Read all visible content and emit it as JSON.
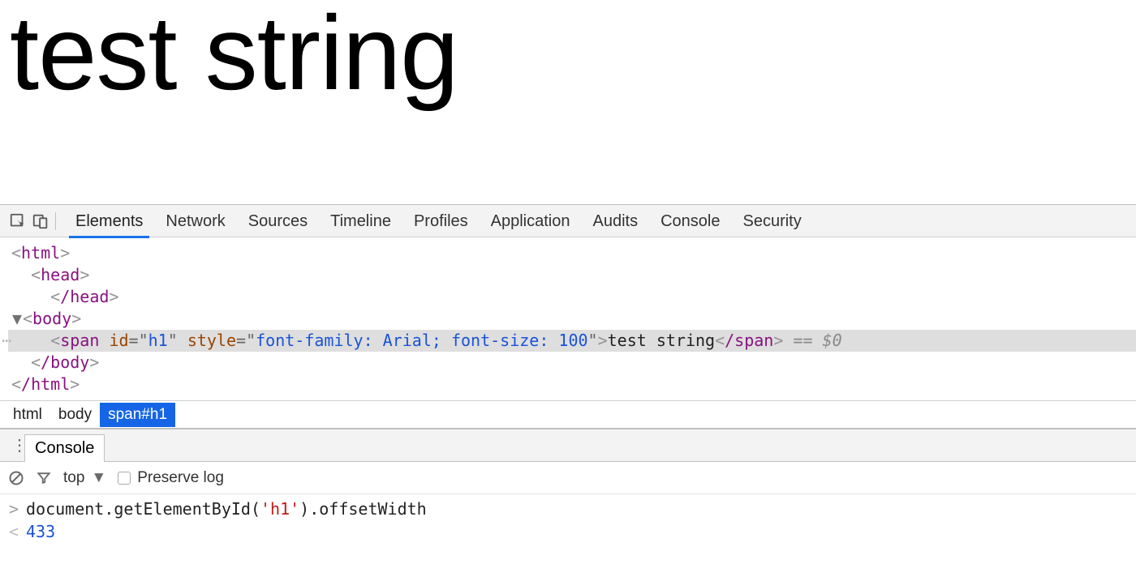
{
  "page": {
    "text": "test string"
  },
  "devtools": {
    "tabs": [
      "Elements",
      "Network",
      "Sources",
      "Timeline",
      "Profiles",
      "Application",
      "Audits",
      "Console",
      "Security"
    ],
    "active_tab": "Elements"
  },
  "dom": {
    "open_html": "html",
    "open_head": "head",
    "close_head": "/head",
    "open_body": "body",
    "span_tag": "span",
    "span_attrs": {
      "id_name": "id",
      "id_value": "h1",
      "style_name": "style",
      "style_value": "font-family: Arial; font-size: 100"
    },
    "span_text": "test string",
    "close_span": "/span",
    "selected_suffix": " == $0",
    "close_body": "/body",
    "close_html": "/html"
  },
  "crumbs": {
    "c1": "html",
    "c2": "body",
    "c3": "span#h1"
  },
  "drawer": {
    "tab": "Console"
  },
  "console_toolbar": {
    "context": "top",
    "preserve_label": "Preserve log"
  },
  "console": {
    "input_pre": "document.getElementById(",
    "input_arg": "'h1'",
    "input_post": ").offsetWidth",
    "output": "433"
  }
}
